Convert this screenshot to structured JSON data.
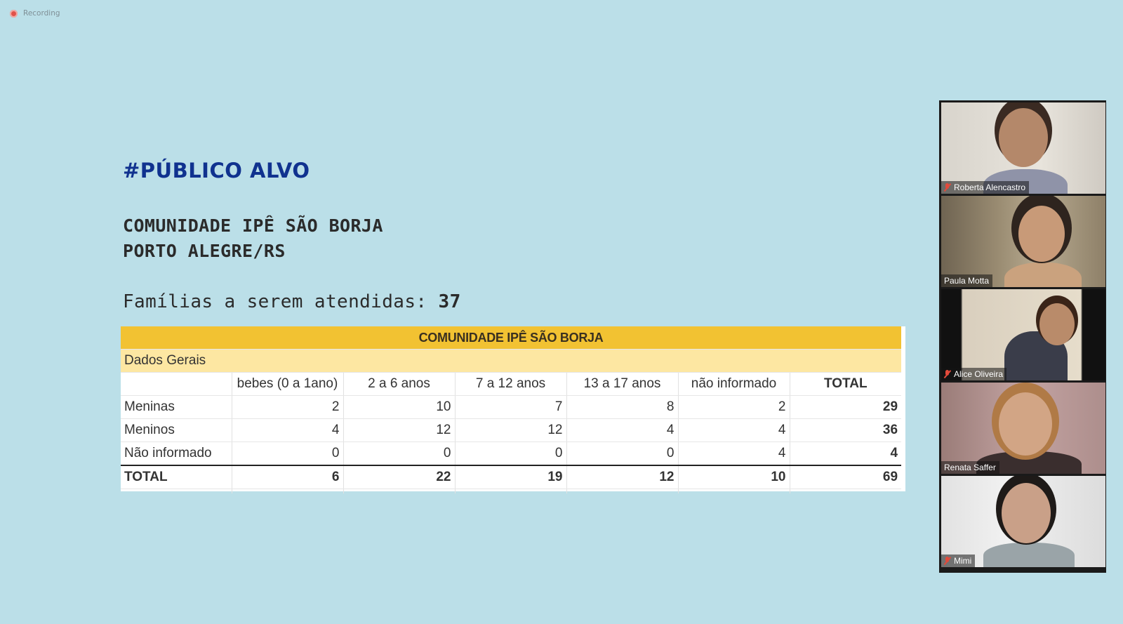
{
  "recording": {
    "label": "Recording"
  },
  "slide": {
    "title": "#PÚBLICO ALVO",
    "subtitle_line1": "COMUNIDADE IPÊ SÃO BORJA",
    "subtitle_line2": "PORTO ALEGRE/RS",
    "families_label": "Famílias a serem atendidas:",
    "families_value": "37"
  },
  "table": {
    "title": "COMUNIDADE IPÊ SÃO BORJA",
    "section": "Dados Gerais",
    "headers": [
      "",
      "bebes (0 a 1ano)",
      "2 a 6 anos",
      "7 a 12 anos",
      "13 a 17 anos",
      "não informado",
      "TOTAL"
    ],
    "rows": [
      {
        "label": "Meninas",
        "values": [
          "2",
          "10",
          "7",
          "8",
          "2",
          "29"
        ]
      },
      {
        "label": "Meninos",
        "values": [
          "4",
          "12",
          "12",
          "4",
          "4",
          "36"
        ]
      },
      {
        "label": "Não informado",
        "values": [
          "0",
          "0",
          "0",
          "0",
          "4",
          "4"
        ]
      }
    ],
    "total_row": {
      "label": "TOTAL",
      "values": [
        "6",
        "22",
        "19",
        "12",
        "10",
        "69"
      ]
    }
  },
  "participants": [
    {
      "name": "Roberta Alencastro",
      "muted": true,
      "active": false
    },
    {
      "name": "Paula Motta",
      "muted": false,
      "active": true
    },
    {
      "name": "Alice Oliveira",
      "muted": true,
      "active": false
    },
    {
      "name": "Renata Saffer",
      "muted": false,
      "active": false
    },
    {
      "name": "Mimi",
      "muted": true,
      "active": false
    }
  ],
  "colors": {
    "background": "#bbdfe8",
    "title": "#10328f",
    "table_header": "#f2c232",
    "table_subheader": "#fde7a2",
    "active_speaker": "#9bd33a",
    "muted_icon": "#e24a3b"
  },
  "icons": {
    "recording": "record-dot-icon",
    "muted": "mic-muted-icon"
  }
}
